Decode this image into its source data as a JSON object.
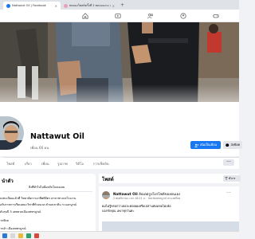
{
  "browser": {
    "tabs": [
      {
        "title": "Nattawut Oil | Facebook",
        "active": true
      },
      {
        "title": "ทดลองโพสต์ครั้งที่ 2 ทดลองแรง แอ็กเคยใจกไป",
        "active": false
      }
    ],
    "close_symbol": "×",
    "new_tab_symbol": "+"
  },
  "fb_nav": {
    "icons": [
      "home-icon",
      "video-icon",
      "friends-icon",
      "groups-icon",
      "gaming-icon"
    ]
  },
  "profile": {
    "name": "Nattawut Oil",
    "followers": "เพื่อน 66 คน",
    "add_friend_label": "เพิ่มเป็นเพื่อน",
    "message_label": "ส่งข้อค",
    "more_symbol": "···"
  },
  "profile_tabs": [
    "โพสต์",
    "เกี่ยว",
    "เพื่อน",
    "รูปภาพ",
    "วิดีโอ",
    "การเช็คอิน"
  ],
  "intro": {
    "title": "นำตัว",
    "bio": "สิ่งที่ทำไปไม่มีผลกับใจเธอเลย",
    "lines": [
      "ลงทะเบียนแล้วที่ วิทยาลัยการอาชีพพิจิตร สาขาช่างกลโรงงาน",
      "อรับราชการเรียนคณะวิชาที่ห้วยนวล ตำบลเขาดิน ระแอกบูรณ์",
      "ดับรุ่นปี 3 เสพชวลเมืองเพชรบูรณ์",
      "ากพิกล",
      "ากอำ เมืองเพชรบูรณ์"
    ]
  },
  "posts": {
    "title": "โพสต์",
    "filter_label": "ตัวกร",
    "post": {
      "author": "Nattawut Oil",
      "action": "อัปเดตรูปโปรไฟล์ของตนเอง",
      "time": "2 พฤศจิกายน เวลา 18:21 น. · จังหวัดเพชรบูรณ์ ประเทศไทย",
      "lines": [
        "ผมไม่รู้หรอกว่าเธอจะคอยผมหรือเปล่าแต่ผมขอไม่เพ้อ",
        "บอกรักคุณ เหงาทุกวันค่ะ"
      ],
      "more_symbol": "···"
    }
  },
  "colors": {
    "accent": "#1877f2",
    "text": "#050505",
    "muted": "#65676b",
    "page_bg": "#f0f2f5"
  }
}
